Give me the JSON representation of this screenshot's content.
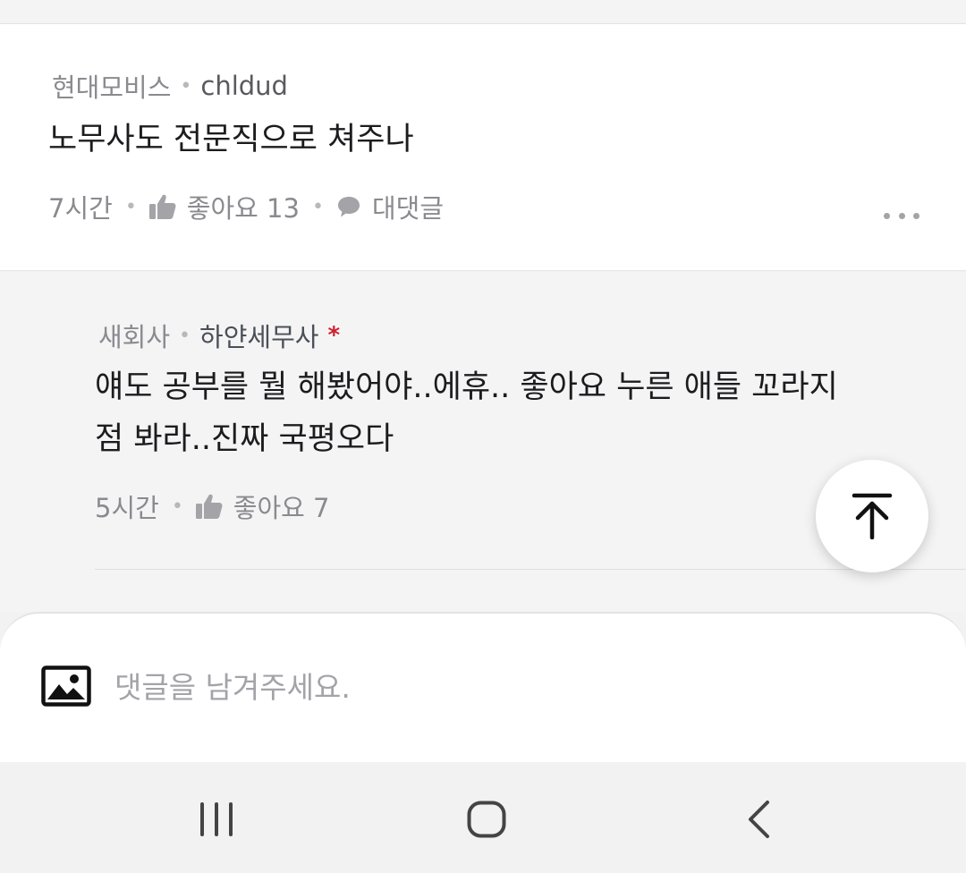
{
  "comment": {
    "company": "현대모비스",
    "author": "chldud",
    "text": "노무사도 전문직으로 쳐주나",
    "time": "7시간",
    "like_label": "좋아요 13",
    "reply_label": "대댓글",
    "more_icon": "more-horizontal-icon"
  },
  "reply": {
    "company": "새회사",
    "author": "하얀세무사",
    "verified_mark": "*",
    "verified_color": "#d0202e",
    "text_line1": "얘도 공부를 뭘 해봤어야..에휴.. 좋아요 누른 애들 꼬라지",
    "text_line2": "점 봐라..진짜 국평오다",
    "time": "5시간",
    "like_label": "좋아요 7"
  },
  "scroll_top_icon": "arrow-up-to-top-icon",
  "input": {
    "placeholder": "댓글을 남겨주세요.",
    "value": "",
    "attach_icon": "image-icon"
  },
  "nav": {
    "recent_icon": "recent-apps-icon",
    "home_icon": "home-icon",
    "back_icon": "back-icon"
  }
}
